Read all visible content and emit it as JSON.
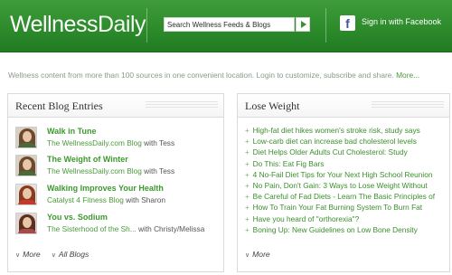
{
  "header": {
    "logo_part1": "Wellness",
    "logo_part2": "Daily",
    "search_placeholder": "Search Wellness Feeds & Blogs",
    "search_button_icon": "arrow-right-icon",
    "facebook_icon": "facebook-icon",
    "facebook_label": "Sign in with Facebook"
  },
  "subtitle": {
    "text": "Wellness content from more than 100 sources in one convenient location. Login to customize, subscribe and share. ",
    "more": "More..."
  },
  "recent_blogs": {
    "title": "Recent Blog Entries",
    "entries": [
      {
        "title": "Walk in Tune",
        "source": "The WellnessDaily.com Blog",
        "with": " with Tess"
      },
      {
        "title": "The Weight of Winter",
        "source": "The WellnessDaily.com Blog",
        "with": " with Tess"
      },
      {
        "title": "Walking Improves Your Health",
        "source": "Catalyst 4 Fitness Blog",
        "with": " with Sharon"
      },
      {
        "title": "You vs. Sodium",
        "source": "The Sisterhood of the Sh...",
        "with": " with Christy/Melissa"
      }
    ],
    "more_label": "More",
    "all_blogs_label": "All Blogs"
  },
  "lose_weight": {
    "title": "Lose Weight",
    "items": [
      "High-fat diet hikes women's stroke risk, study says",
      "Low-carb diet can increase bad cholesterol levels",
      "Diet Helps Older Adults Cut Cholesterol: Study",
      "Do This: Eat Fig Bars",
      "4 No-Fail Diet Tips for Your Next High School Reunion",
      "No Pain, Don't Gain: 3 Ways to Lose Weight Without",
      "Be Careful of Fad Diets - Learn The Basic Principles of",
      "How To Train Your Fat Burning System To Burn Fat",
      "Have you heard of \"orthorexia\"?",
      "Boning Up: New Guidelines on Low Bone Density"
    ],
    "more_label": "More"
  },
  "colors": {
    "header_green": "#2c8a2b",
    "link_green": "#3c9a2e",
    "facebook_blue": "#3b5998"
  }
}
